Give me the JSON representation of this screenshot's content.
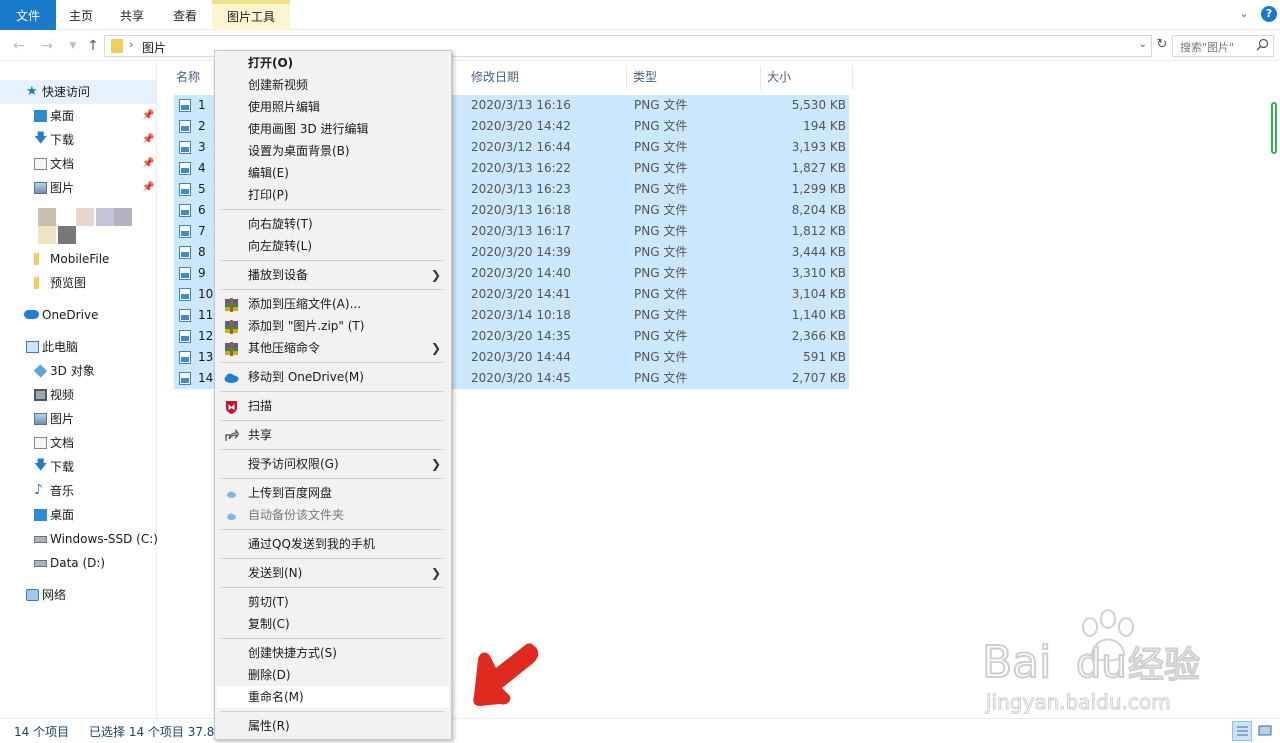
{
  "ribbon": {
    "tabs": {
      "file": "文件",
      "home": "主页",
      "share": "共享",
      "view": "查看",
      "pictures_tools": "图片工具"
    },
    "help": "?"
  },
  "address": {
    "path": "图片",
    "search_placeholder": "搜索\"图片\""
  },
  "nav": {
    "quick_access": "快速访问",
    "quick_items": [
      "桌面",
      "下载",
      "文档",
      "图片"
    ],
    "extra_items": [
      "MobileFile",
      "预览图"
    ],
    "onedrive": "OneDrive",
    "this_pc": "此电脑",
    "pc_items": [
      "3D 对象",
      "视频",
      "图片",
      "文档",
      "下载",
      "音乐",
      "桌面",
      "Windows-SSD (C:)",
      "Data (D:)"
    ],
    "network": "网络"
  },
  "columns": {
    "name": "名称",
    "date": "修改日期",
    "type": "类型",
    "size": "大小"
  },
  "files": [
    {
      "name": "1",
      "date": "2020/3/13 16:16",
      "type": "PNG 文件",
      "size": "5,530 KB"
    },
    {
      "name": "2",
      "date": "2020/3/20 14:42",
      "type": "PNG 文件",
      "size": "194 KB"
    },
    {
      "name": "3",
      "date": "2020/3/12 16:44",
      "type": "PNG 文件",
      "size": "3,193 KB"
    },
    {
      "name": "4",
      "date": "2020/3/13 16:22",
      "type": "PNG 文件",
      "size": "1,827 KB"
    },
    {
      "name": "5",
      "date": "2020/3/13 16:23",
      "type": "PNG 文件",
      "size": "1,299 KB"
    },
    {
      "name": "6",
      "date": "2020/3/13 16:18",
      "type": "PNG 文件",
      "size": "8,204 KB"
    },
    {
      "name": "7",
      "date": "2020/3/13 16:17",
      "type": "PNG 文件",
      "size": "1,812 KB"
    },
    {
      "name": "8",
      "date": "2020/3/20 14:39",
      "type": "PNG 文件",
      "size": "3,444 KB"
    },
    {
      "name": "9",
      "date": "2020/3/20 14:40",
      "type": "PNG 文件",
      "size": "3,310 KB"
    },
    {
      "name": "10",
      "date": "2020/3/20 14:41",
      "type": "PNG 文件",
      "size": "3,104 KB"
    },
    {
      "name": "11",
      "date": "2020/3/14 10:18",
      "type": "PNG 文件",
      "size": "1,140 KB"
    },
    {
      "name": "12",
      "date": "2020/3/20 14:35",
      "type": "PNG 文件",
      "size": "2,366 KB"
    },
    {
      "name": "13",
      "date": "2020/3/20 14:44",
      "type": "PNG 文件",
      "size": "591 KB"
    },
    {
      "name": "14",
      "date": "2020/3/20 14:45",
      "type": "PNG 文件",
      "size": "2,707 KB"
    }
  ],
  "context_menu": [
    {
      "label": "打开(O)",
      "bold": true
    },
    {
      "label": "创建新视频"
    },
    {
      "label": "使用照片编辑"
    },
    {
      "label": "使用画图 3D 进行编辑"
    },
    {
      "label": "设置为桌面背景(B)"
    },
    {
      "label": "编辑(E)"
    },
    {
      "label": "打印(P)"
    },
    {
      "sep": true
    },
    {
      "label": "向右旋转(T)"
    },
    {
      "label": "向左旋转(L)"
    },
    {
      "sep": true
    },
    {
      "label": "播放到设备",
      "submenu": true
    },
    {
      "sep": true
    },
    {
      "label": "添加到压缩文件(A)...",
      "icon": "winrar-icon"
    },
    {
      "label": "添加到 \"图片.zip\" (T)",
      "icon": "winrar-icon"
    },
    {
      "label": "其他压缩命令",
      "icon": "winrar-icon",
      "submenu": true
    },
    {
      "sep": true
    },
    {
      "label": "移动到 OneDrive(M)",
      "icon": "onedrive-icon"
    },
    {
      "sep": true
    },
    {
      "label": "扫描",
      "icon": "mcafee-icon"
    },
    {
      "sep": true
    },
    {
      "label": "共享",
      "icon": "share-icon"
    },
    {
      "sep": true
    },
    {
      "label": "授予访问权限(G)",
      "submenu": true
    },
    {
      "sep": true
    },
    {
      "label": "上传到百度网盘",
      "icon": "baidu-cloud-icon"
    },
    {
      "label": "自动备份该文件夹",
      "icon": "baidu-cloud-icon",
      "disabled": true
    },
    {
      "sep": true
    },
    {
      "label": "通过QQ发送到我的手机"
    },
    {
      "sep": true
    },
    {
      "label": "发送到(N)",
      "submenu": true
    },
    {
      "sep": true
    },
    {
      "label": "剪切(T)"
    },
    {
      "label": "复制(C)"
    },
    {
      "sep": true
    },
    {
      "label": "创建快捷方式(S)"
    },
    {
      "label": "删除(D)"
    },
    {
      "label": "重命名(M)",
      "highlighted": true
    },
    {
      "sep": true
    },
    {
      "label": "属性(R)"
    }
  ],
  "status": {
    "count": "14 个项目",
    "selected": "已选择 14 个项目  37.8"
  },
  "watermark": {
    "brand": "Bai",
    "brand2": "du",
    "product": "经验",
    "url": "jingyan.baidu.com"
  },
  "colors": {
    "accent": "#1979ca",
    "selection": "#cce8ff",
    "annotation_arrow": "#e0291f"
  }
}
